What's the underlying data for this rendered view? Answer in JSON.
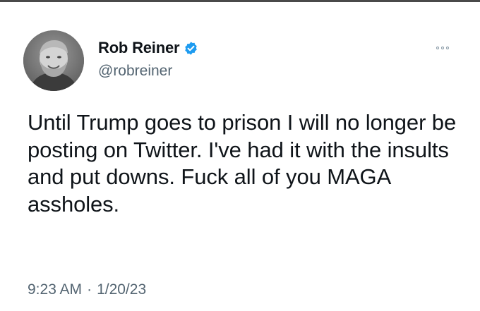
{
  "tweet": {
    "display_name": "Rob Reiner",
    "handle": "@robreiner",
    "text": "Until Trump goes to prison I will no longer be posting on Twitter. I've had it with the insults and put downs. Fuck all of you MAGA assholes.",
    "time": "9:23 AM",
    "separator": "·",
    "date": "1/20/23"
  },
  "icons": {
    "verified": "verified-badge-icon",
    "more": "more-options-icon"
  },
  "colors": {
    "verified": "#1d9bf0",
    "text": "#0f1419",
    "secondary": "#536471"
  }
}
